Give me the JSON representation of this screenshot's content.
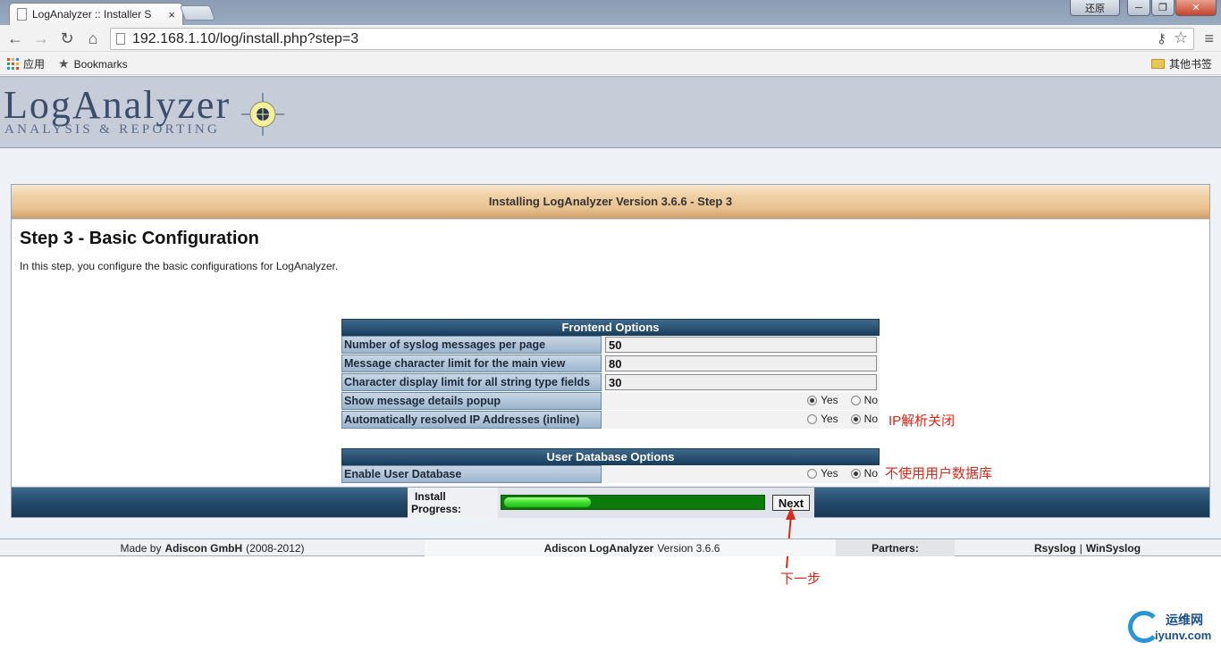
{
  "browser": {
    "tab_title": "LogAnalyzer :: Installer S",
    "tab_close": "×",
    "window_controls": {
      "restore_label": "还原",
      "minimize": "─",
      "maximize": "❐",
      "close": "✕"
    },
    "url": "192.168.1.10/log/install.php?step=3",
    "bookmarks": {
      "apps_label": "应用",
      "bookmarks_label": "Bookmarks",
      "other_label": "其他书签"
    }
  },
  "logo": {
    "main": "LogAnalyzer",
    "sub": "ANALYSIS & REPORTING"
  },
  "page": {
    "install_title": "Installing LogAnalyzer Version 3.6.6 - Step 3",
    "step_heading": "Step 3 - Basic Configuration",
    "step_desc": "In this step, you configure the basic configurations for LogAnalyzer."
  },
  "frontend": {
    "header": "Frontend Options",
    "rows": [
      {
        "label": "Number of syslog messages per page",
        "value": "50"
      },
      {
        "label": "Message character limit for the main view",
        "value": "80"
      },
      {
        "label": "Character display limit for all string type fields",
        "value": "30"
      }
    ],
    "radio_rows": [
      {
        "label": "Show message details popup",
        "yes": "Yes",
        "no": "No",
        "selected": "yes"
      },
      {
        "label": "Automatically resolved IP Addresses (inline)",
        "yes": "Yes",
        "no": "No",
        "selected": "no"
      }
    ]
  },
  "userdb": {
    "header": "User Database Options",
    "row": {
      "label": "Enable User Database",
      "yes": "Yes",
      "no": "No",
      "selected": "no"
    }
  },
  "annotations": {
    "ip_note": "IP解析关闭",
    "db_note": "不使用用户数据库",
    "next_note": "下一步"
  },
  "progress": {
    "label_line1": "Install",
    "label_line2": "Progress:",
    "percent": 0.33,
    "next_label": "Next"
  },
  "footer": {
    "made_by_prefix": "Made by",
    "made_by_company": "Adiscon GmbH",
    "made_by_years": "(2008-2012)",
    "product_name": "Adiscon LogAnalyzer",
    "product_version": "Version 3.6.6",
    "partners_label": "Partners:",
    "partner1": "Rsyslog",
    "separator": "|",
    "partner2": "WinSyslog"
  },
  "watermark": {
    "cn": "运维网",
    "en": "iyunv.com"
  },
  "colors": {
    "accent_red": "#d62b1e",
    "progress_green": "#3fdf2f",
    "header_blue": "#1b3f5e"
  }
}
